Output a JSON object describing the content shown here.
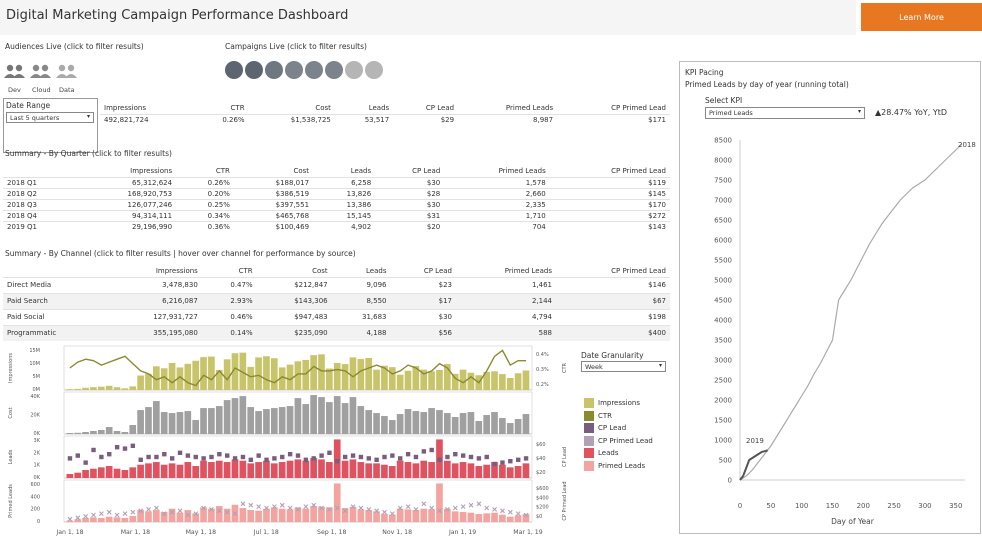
{
  "header": {
    "title": "Digital Marketing Campaign Performance Dashboard",
    "learn_more": "Learn More",
    "accent_color": "#e87722"
  },
  "audiences": {
    "label": "Audiences Live (click to filter results)",
    "items": [
      {
        "label": "Dev",
        "icon": "people-icon"
      },
      {
        "label": "Cloud",
        "icon": "people-icon"
      },
      {
        "label": "Data",
        "icon": "people-icon"
      }
    ]
  },
  "campaigns": {
    "label": "Campaigns Live (click to filter results)",
    "count": 8,
    "colors": [
      "#5d6670",
      "#5d6670",
      "#6f7780",
      "#7c838c",
      "#7c838c",
      "#7c838c",
      "#b5b5b5",
      "#b5b5b5"
    ]
  },
  "date_range": {
    "label": "Date Range",
    "value": "Last 5 quarters"
  },
  "totals": {
    "headers": [
      "Impressions",
      "CTR",
      "Cost",
      "Leads",
      "CP Lead",
      "Primed Leads",
      "CP Primed Lead"
    ],
    "values": [
      "492,821,724",
      "0.26%",
      "$1,538,725",
      "53,517",
      "$29",
      "8,987",
      "$171"
    ]
  },
  "by_quarter": {
    "label": "Summary - By Quarter (click to filter results)",
    "headers": [
      "",
      "Impressions",
      "CTR",
      "Cost",
      "Leads",
      "CP Lead",
      "Primed Leads",
      "CP Primed Lead"
    ],
    "rows": [
      [
        "2018 Q1",
        "65,312,624",
        "0.26%",
        "$188,017",
        "6,258",
        "$30",
        "1,578",
        "$119"
      ],
      [
        "2018 Q2",
        "168,920,753",
        "0.20%",
        "$386,519",
        "13,826",
        "$28",
        "2,660",
        "$145"
      ],
      [
        "2018 Q3",
        "126,077,246",
        "0.25%",
        "$397,551",
        "13,386",
        "$30",
        "2,335",
        "$170"
      ],
      [
        "2018 Q4",
        "94,314,111",
        "0.34%",
        "$465,768",
        "15,145",
        "$31",
        "1,710",
        "$272"
      ],
      [
        "2019 Q1",
        "29,196,990",
        "0.36%",
        "$100,469",
        "4,902",
        "$20",
        "704",
        "$143"
      ]
    ]
  },
  "by_channel": {
    "label": "Summary - By Channel (click to filter results | hover over channel for performance by source)",
    "headers": [
      "",
      "Impressions",
      "CTR",
      "Cost",
      "Leads",
      "CP Lead",
      "Primed Leads",
      "CP Primed Lead"
    ],
    "rows": [
      [
        "Direct Media",
        "3,478,830",
        "0.47%",
        "$212,847",
        "9,096",
        "$23",
        "1,461",
        "$146"
      ],
      [
        "Paid Search",
        "6,216,087",
        "2.93%",
        "$143,306",
        "8,550",
        "$17",
        "2,144",
        "$67"
      ],
      [
        "Paid Social",
        "127,931,727",
        "0.46%",
        "$947,483",
        "31,683",
        "$30",
        "4,794",
        "$198"
      ],
      [
        "Programmatic",
        "355,195,080",
        "0.14%",
        "$235,090",
        "4,188",
        "$56",
        "588",
        "$400"
      ]
    ]
  },
  "granularity": {
    "label": "Date Granularity",
    "value": "Week"
  },
  "legend": [
    {
      "label": "Impressions",
      "color": "#c8c46a"
    },
    {
      "label": "CTR",
      "color": "#8b8a2e"
    },
    {
      "label": "CP Lead",
      "color": "#7a5c7e"
    },
    {
      "label": "CP Primed Lead",
      "color": "#b2a0b5"
    },
    {
      "label": "Leads",
      "color": "#e05260"
    },
    {
      "label": "Primed Leads",
      "color": "#f4a4a0"
    }
  ],
  "timeline": {
    "panel_labels": [
      "Impressions",
      "Cost",
      "Leads",
      "Primed Leads"
    ],
    "right_labels": [
      "CTR",
      "CP Lead",
      "CP Primed Lead"
    ],
    "left_ticks": [
      [
        "15M",
        "10M",
        "5M",
        "0M"
      ],
      [
        "40K",
        "20K",
        "0K"
      ],
      [
        "3K",
        "2K",
        "1K",
        "0K"
      ],
      [
        "600",
        "400",
        "200",
        "0"
      ]
    ],
    "right_ticks": [
      [
        "0.4%",
        "0.3%",
        "0.2%"
      ],
      [
        "$60",
        "$40",
        "$20"
      ],
      [
        "$600",
        "$400",
        "$200",
        "$0"
      ]
    ],
    "x_ticks": [
      "Jan 1, 18",
      "Mar 1, 18",
      "May 1, 18",
      "Jul 1, 18",
      "Sep 1, 18",
      "Nov 1, 18",
      "Jan 1, 19",
      "Mar 1, 19"
    ]
  },
  "chart_data": [
    {
      "type": "bar",
      "title": "",
      "series": [
        {
          "name": "Impressions",
          "values": [
            0.3,
            0.4,
            0.8,
            1.0,
            1.2,
            1.5,
            1.0,
            0.6,
            1.3,
            5.2,
            5.8,
            8.5,
            7.8,
            9.7,
            8.1,
            9.4,
            10.5,
            11.8,
            12.0,
            7.2,
            11.0,
            13.2,
            13.4,
            8.3,
            11.7,
            12.1,
            11.4,
            8.1,
            9.1,
            10.3,
            10.8,
            12.5,
            12.8,
            7.7,
            9.7,
            9.3,
            11.7,
            11.1,
            11.5,
            7.3,
            8.7,
            8.2,
            5.5,
            6.9,
            8.6,
            7.3,
            6.7,
            7.2,
            9.3,
            5.8,
            7.3,
            6.2,
            5.3,
            6.5,
            6.7,
            5.7,
            4.3,
            6.0,
            7.0
          ]
        },
        {
          "name": "CTR",
          "values": [
            0.3,
            0.34,
            0.36,
            0.35,
            0.32,
            0.34,
            0.36,
            0.38,
            0.33,
            0.28,
            0.26,
            0.22,
            0.24,
            0.2,
            0.24,
            0.2,
            0.18,
            0.25,
            0.22,
            0.28,
            0.22,
            0.3,
            0.27,
            0.24,
            0.25,
            0.22,
            0.2,
            0.24,
            0.22,
            0.26,
            0.26,
            0.31,
            0.28,
            0.28,
            0.29,
            0.28,
            0.24,
            0.28,
            0.3,
            0.32,
            0.3,
            0.26,
            0.28,
            0.32,
            0.3,
            0.26,
            0.28,
            0.33,
            0.3,
            0.23,
            0.2,
            0.24,
            0.2,
            0.28,
            0.38,
            0.42,
            0.32,
            0.35,
            0.35
          ]
        }
      ]
    },
    {
      "type": "bar",
      "title": "",
      "series": [
        {
          "name": "Cost",
          "values": [
            1000,
            1200,
            2000,
            3000,
            4000,
            7000,
            3000,
            2000,
            9000,
            24000,
            27000,
            33000,
            22000,
            21000,
            22000,
            23000,
            14000,
            26000,
            26000,
            28000,
            34000,
            36000,
            38000,
            27000,
            23000,
            25000,
            26000,
            27000,
            28000,
            36000,
            30000,
            39000,
            37000,
            32000,
            38000,
            31000,
            37000,
            28000,
            24000,
            21000,
            18000,
            14000,
            20000,
            25000,
            23000,
            22000,
            26000,
            24000,
            21000,
            17000,
            21000,
            22000,
            13000,
            19000,
            22000,
            16000,
            11000,
            15000,
            20000
          ]
        }
      ]
    },
    {
      "type": "bar",
      "title": "",
      "series": [
        {
          "name": "Leads",
          "values": [
            300,
            400,
            600,
            700,
            800,
            900,
            700,
            600,
            800,
            1000,
            1100,
            1200,
            1000,
            1100,
            1000,
            1200,
            900,
            1300,
            1200,
            1300,
            1200,
            1400,
            1300,
            1100,
            1200,
            1300,
            1100,
            1200,
            1300,
            1400,
            1300,
            1500,
            1400,
            1200,
            2900,
            1300,
            1400,
            1200,
            1100,
            1100,
            1000,
            900,
            1300,
            1200,
            1100,
            1300,
            1200,
            2900,
            1300,
            1100,
            1200,
            1100,
            900,
            1000,
            1200,
            1000,
            800,
            900,
            1100
          ]
        },
        {
          "name": "CP Lead",
          "values": [
            28,
            32,
            22,
            40,
            30,
            34,
            44,
            42,
            46,
            26,
            30,
            30,
            34,
            28,
            36,
            32,
            30,
            28,
            30,
            34,
            32,
            28,
            30,
            26,
            32,
            26,
            28,
            30,
            34,
            32,
            26,
            28,
            32,
            36,
            24,
            30,
            32,
            30,
            28,
            26,
            30,
            32,
            28,
            34,
            30,
            38,
            40,
            26,
            30,
            34,
            32,
            30,
            28,
            30,
            20,
            22,
            24,
            26,
            28
          ]
        }
      ]
    },
    {
      "type": "bar",
      "title": "",
      "series": [
        {
          "name": "Primed Leads",
          "values": [
            20,
            40,
            60,
            70,
            60,
            80,
            70,
            60,
            90,
            180,
            160,
            180,
            150,
            200,
            140,
            180,
            130,
            220,
            200,
            240,
            200,
            260,
            210,
            180,
            170,
            200,
            220,
            200,
            190,
            220,
            200,
            240,
            230,
            220,
            580,
            210,
            230,
            190,
            180,
            160,
            120,
            110,
            200,
            190,
            180,
            200,
            190,
            580,
            200,
            160,
            150,
            140,
            120,
            130,
            140,
            110,
            80,
            100,
            120
          ]
        },
        {
          "name": "CP Primed Lead",
          "values": [
            40,
            60,
            80,
            100,
            120,
            140,
            100,
            120,
            140,
            160,
            180,
            200,
            120,
            140,
            160,
            100,
            120,
            200,
            180,
            160,
            140,
            120,
            260,
            240,
            220,
            200,
            220,
            240,
            200,
            180,
            220,
            240,
            200,
            180,
            200,
            160,
            220,
            200,
            180,
            160,
            140,
            120,
            200,
            220,
            180,
            260,
            200,
            160,
            180,
            200,
            220,
            240,
            260,
            200,
            180,
            160,
            140,
            120,
            100
          ]
        }
      ]
    },
    {
      "type": "line",
      "title": "KPI Pacing",
      "subtitle": "Primed Leads by day of year (running total)",
      "xlabel": "Day of Year",
      "ylim": [
        0,
        8500
      ],
      "xlim": [
        0,
        365
      ],
      "series": [
        {
          "name": "2018",
          "x": [
            0,
            10,
            20,
            30,
            40,
            50,
            60,
            70,
            80,
            90,
            100,
            110,
            120,
            130,
            140,
            150,
            160,
            170,
            180,
            190,
            200,
            210,
            220,
            230,
            240,
            250,
            260,
            270,
            280,
            290,
            300,
            310,
            320,
            330,
            340,
            350,
            360
          ],
          "values": [
            0,
            100,
            250,
            450,
            650,
            850,
            1100,
            1350,
            1600,
            1850,
            2100,
            2350,
            2650,
            2900,
            3200,
            3500,
            4500,
            4750,
            5000,
            5300,
            5600,
            5900,
            6150,
            6400,
            6600,
            6800,
            7000,
            7150,
            7300,
            7400,
            7500,
            7650,
            7800,
            7950,
            8100,
            8250,
            8400
          ]
        },
        {
          "name": "2019",
          "x": [
            0,
            5,
            10,
            15,
            20,
            25,
            30,
            35,
            40,
            45
          ],
          "values": [
            0,
            100,
            300,
            500,
            550,
            600,
            650,
            700,
            720,
            740
          ]
        }
      ]
    }
  ],
  "kpi": {
    "title": "KPI Pacing",
    "subtitle": "Primed Leads by day of year (running total)",
    "select_label": "Select KPI",
    "select_value": "Primed Leads",
    "yoy": "▲28.47% YoY, YtD",
    "y_ticks": [
      "8500",
      "8000",
      "7500",
      "7000",
      "6500",
      "6000",
      "5500",
      "5000",
      "4500",
      "4000",
      "3500",
      "3000",
      "2500",
      "2000",
      "1500",
      "1000",
      "500",
      "0"
    ],
    "x_ticks": [
      "0",
      "50",
      "100",
      "150",
      "200",
      "250",
      "300",
      "350"
    ],
    "xlabel": "Day of Year",
    "label_2018": "2018",
    "label_2019": "2019"
  }
}
